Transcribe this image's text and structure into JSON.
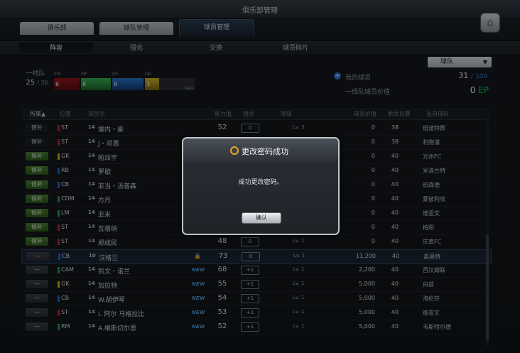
{
  "window": {
    "title": "俱乐部管理"
  },
  "main_tabs": [
    {
      "label": "俱乐部"
    },
    {
      "label": "球队管理"
    },
    {
      "label": "球员管理"
    }
  ],
  "sub_tabs": [
    {
      "label": "阵容"
    },
    {
      "label": "强化"
    },
    {
      "label": "交换"
    },
    {
      "label": "球员碎片"
    }
  ],
  "filter": {
    "selected": "球队",
    "arrow": "▼"
  },
  "squad": {
    "label": "一线队",
    "count": "25",
    "max": "/ 36",
    "positions": [
      {
        "tag": "FW",
        "count": "6",
        "color": "#b8202a"
      },
      {
        "tag": "MF",
        "count": "8",
        "color": "#2ca84a"
      },
      {
        "tag": "DF",
        "count": "8",
        "color": "#1d6fd0"
      },
      {
        "tag": "GK",
        "count": "3",
        "color": "#d8b81c"
      }
    ],
    "max_tag": "Max"
  },
  "my_players": {
    "label": "我的球员",
    "value": "31",
    "max": "/ 100"
  },
  "team_value": {
    "label": "一线队球员价值",
    "value": "0",
    "unit": "EP"
  },
  "table": {
    "headers": {
      "belong": "所属▲",
      "position": "位置",
      "name": "球员名",
      "ovr": "能力值",
      "enhance": "强化",
      "level": "等级",
      "value": "球员价值",
      "matches": "剩余比赛",
      "club": "出自球队"
    },
    "rows": [
      {
        "status": "替补",
        "status_type": "sub",
        "pos": "ST",
        "pos_color": "#c92a2a",
        "grade": "14",
        "name": "雷内・豪",
        "tag": "",
        "ovr": "52",
        "enh": "0",
        "lv": "Lv. 3",
        "value": "0",
        "matches": "38",
        "club": "纽波特郡"
      },
      {
        "status": "替补",
        "status_type": "sub",
        "pos": "ST",
        "pos_color": "#c92a2a",
        "grade": "14",
        "name": "J・邓恩",
        "tag": "",
        "ovr": "",
        "enh": "",
        "lv": "",
        "value": "0",
        "matches": "38",
        "club": "利物浦"
      },
      {
        "status": "候补",
        "status_type": "res",
        "pos": "GK",
        "pos_color": "#d8b81c",
        "grade": "14",
        "name": "帕派宇",
        "tag": "",
        "ovr": "",
        "enh": "",
        "lv": "",
        "value": "0",
        "matches": "40",
        "club": "光州FC"
      },
      {
        "status": "候补",
        "status_type": "res",
        "pos": "RB",
        "pos_color": "#1d6fd0",
        "grade": "14",
        "name": "罗歇",
        "tag": "",
        "ovr": "",
        "enh": "",
        "lv": "",
        "value": "0",
        "matches": "40",
        "club": "米洛兰特"
      },
      {
        "status": "候补",
        "status_type": "res",
        "pos": "CB",
        "pos_color": "#1d6fd0",
        "grade": "14",
        "name": "亚当・汤普森",
        "tag": "",
        "ovr": "",
        "enh": "",
        "lv": "",
        "value": "0",
        "matches": "40",
        "club": "绍森德"
      },
      {
        "status": "候补",
        "status_type": "res",
        "pos": "CDM",
        "pos_color": "#2ca84a",
        "grade": "14",
        "name": "方丹",
        "tag": "",
        "ovr": "",
        "enh": "",
        "lv": "",
        "value": "0",
        "matches": "40",
        "club": "蒙彼利埃"
      },
      {
        "status": "候补",
        "status_type": "res",
        "pos": "LM",
        "pos_color": "#2ca84a",
        "grade": "14",
        "name": "亚米",
        "tag": "",
        "ovr": "",
        "enh": "",
        "lv": "",
        "value": "0",
        "matches": "40",
        "club": "维亚文"
      },
      {
        "status": "候补",
        "status_type": "res",
        "pos": "ST",
        "pos_color": "#c92a2a",
        "grade": "14",
        "name": "瓦格纳",
        "tag": "",
        "ovr": "",
        "enh": "",
        "lv": "",
        "value": "0",
        "matches": "40",
        "club": "柏阳"
      },
      {
        "status": "候补",
        "status_type": "res",
        "pos": "ST",
        "pos_color": "#c92a2a",
        "grade": "14",
        "name": "郑成民",
        "tag": "",
        "ovr": "48",
        "enh": "0",
        "lv": "Lv. 1",
        "value": "0",
        "matches": "40",
        "club": "庆南FC"
      },
      {
        "status": "—",
        "status_type": "none",
        "pos": "CB",
        "pos_color": "#1d6fd0",
        "grade": "10",
        "name": "汉格兰",
        "tag": "lock",
        "ovr": "73",
        "enh": "0",
        "lv": "Lv. 1",
        "value": "11,200",
        "matches": "40",
        "club": "盖莫特"
      },
      {
        "status": "—",
        "status_type": "none",
        "pos": "CAM",
        "pos_color": "#2ca84a",
        "grade": "14",
        "name": "凯文・诺兰",
        "tag": "NEW",
        "ovr": "68",
        "enh": "+1",
        "lv": "Lv. 1",
        "value": "2,200",
        "matches": "40",
        "club": "西汉姆联"
      },
      {
        "status": "—",
        "status_type": "none",
        "pos": "GK",
        "pos_color": "#d8b81c",
        "grade": "14",
        "name": "加拉特",
        "tag": "NEW",
        "ovr": "55",
        "enh": "+1",
        "lv": "Lv. 1",
        "value": "5,000",
        "matches": "40",
        "club": "白首"
      },
      {
        "status": "—",
        "status_type": "none",
        "pos": "CB",
        "pos_color": "#1d6fd0",
        "grade": "14",
        "name": "W.胡伊琴",
        "tag": "NEW",
        "ovr": "54",
        "enh": "+1",
        "lv": "Lv. 1",
        "value": "5,000",
        "matches": "40",
        "club": "海伦芬"
      },
      {
        "status": "—",
        "status_type": "none",
        "pos": "ST",
        "pos_color": "#c92a2a",
        "grade": "14",
        "name": "I. 阿尔 马格拉比",
        "tag": "NEW",
        "ovr": "53",
        "enh": "+1",
        "lv": "Lv. 1",
        "value": "5,000",
        "matches": "40",
        "club": "维亚文"
      },
      {
        "status": "—",
        "status_type": "none",
        "pos": "RM",
        "pos_color": "#2ca84a",
        "grade": "14",
        "name": "A.维斯切尔恩",
        "tag": "NEW",
        "ovr": "52",
        "enh": "+1",
        "lv": "Lv. 1",
        "value": "5,000",
        "matches": "40",
        "club": "韦斯特尔德"
      }
    ]
  },
  "dialog": {
    "title": "更改密码成功",
    "message": "成功更改密码。",
    "confirm": "确认"
  }
}
